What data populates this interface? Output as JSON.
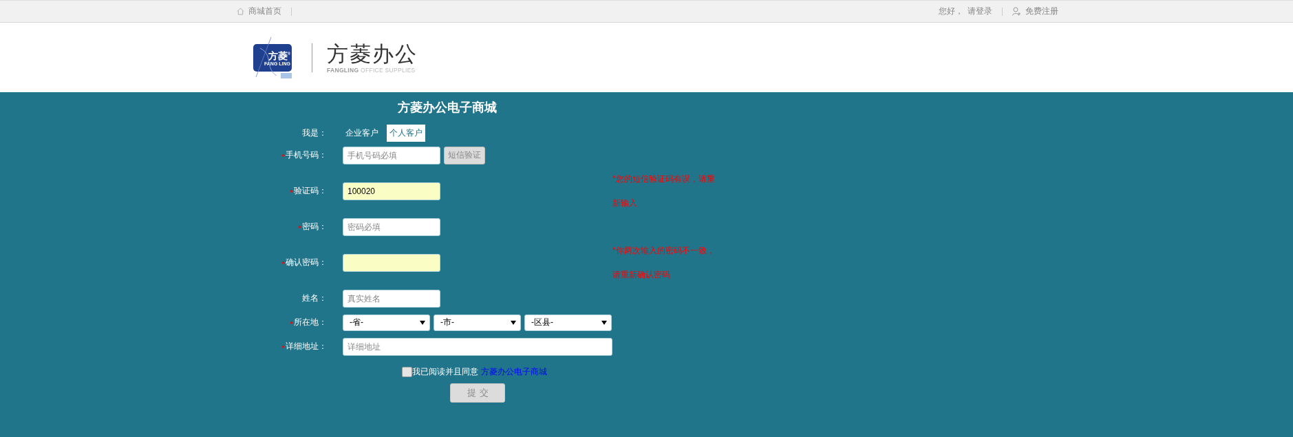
{
  "top_bar": {
    "home_link": "商城首页",
    "greeting": "您好，",
    "login_link": "请登录",
    "register_link": "免费注册"
  },
  "logo": {
    "mark_text": "方菱$^{®}$",
    "mark_subtext": "FANG LING",
    "brand_name": "方菱办公",
    "brand_tagline": "**FANGLING** OFFICE SUPPLIES"
  },
  "form": {
    "title": "方菱办公电子商城",
    "customer_type": {
      "label": "我是：",
      "options": [
        {
          "label": "企业客户",
          "selected": false
        },
        {
          "label": "个人客户",
          "selected": true
        }
      ]
    },
    "fields": [
      {
        "kind": "phone",
        "label": "手机号码：",
        "required": true,
        "placeholder": "手机号码必填",
        "button": "短信验证"
      },
      {
        "kind": "text",
        "label": "验证码：",
        "required": true,
        "value": "100020",
        "highlighted": true,
        "error": "*您的短信验证码有误，请重新输入"
      },
      {
        "kind": "text",
        "label": "密码：",
        "required": true,
        "placeholder": "密码必填",
        "highlighted": false
      },
      {
        "kind": "text",
        "label": "确认密码：",
        "required": true,
        "highlighted": true,
        "error": "*你两次输入的密码不一致，请重新确认密码"
      },
      {
        "kind": "text",
        "label": "姓名：",
        "required": false,
        "placeholder": "真实姓名",
        "highlighted": false
      },
      {
        "kind": "selects",
        "label": "所在地：",
        "required": true,
        "options": [
          "-省-",
          "-市-",
          "-区县-"
        ]
      },
      {
        "kind": "wide",
        "label": "详细地址：",
        "required": true,
        "placeholder": "详细地址"
      }
    ],
    "agreement": {
      "checked": false,
      "text": "我已阅读并且同意",
      "link": "方菱办公电子商城"
    },
    "submit": "提交"
  }
}
